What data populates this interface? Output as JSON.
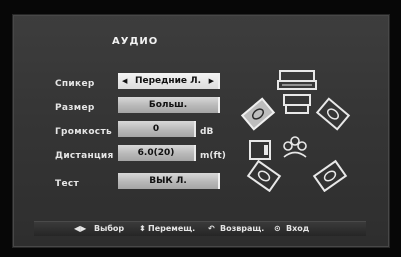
{
  "menu": {
    "title": "АУДИО",
    "rows": [
      {
        "label": "Спикер",
        "value": "Передние Л.",
        "unit": ""
      },
      {
        "label": "Размер",
        "value": "Больш.",
        "unit": ""
      },
      {
        "label": "Громкость",
        "value": "0",
        "unit": "dB"
      },
      {
        "label": "Дистанция",
        "value": "6.0(20)",
        "unit": "m(ft)"
      },
      {
        "label": "Тест",
        "value": "ВЫК Л.",
        "unit": ""
      }
    ]
  },
  "footer": {
    "select": "Выбор",
    "move": "Перемещ.",
    "back": "Возвращ.",
    "enter": "Вход"
  },
  "icons": {
    "speaker_layout": "5.1-speaker-layout-icon",
    "arrow_left": "arrow-left-icon",
    "arrow_right": "arrow-right-icon"
  }
}
